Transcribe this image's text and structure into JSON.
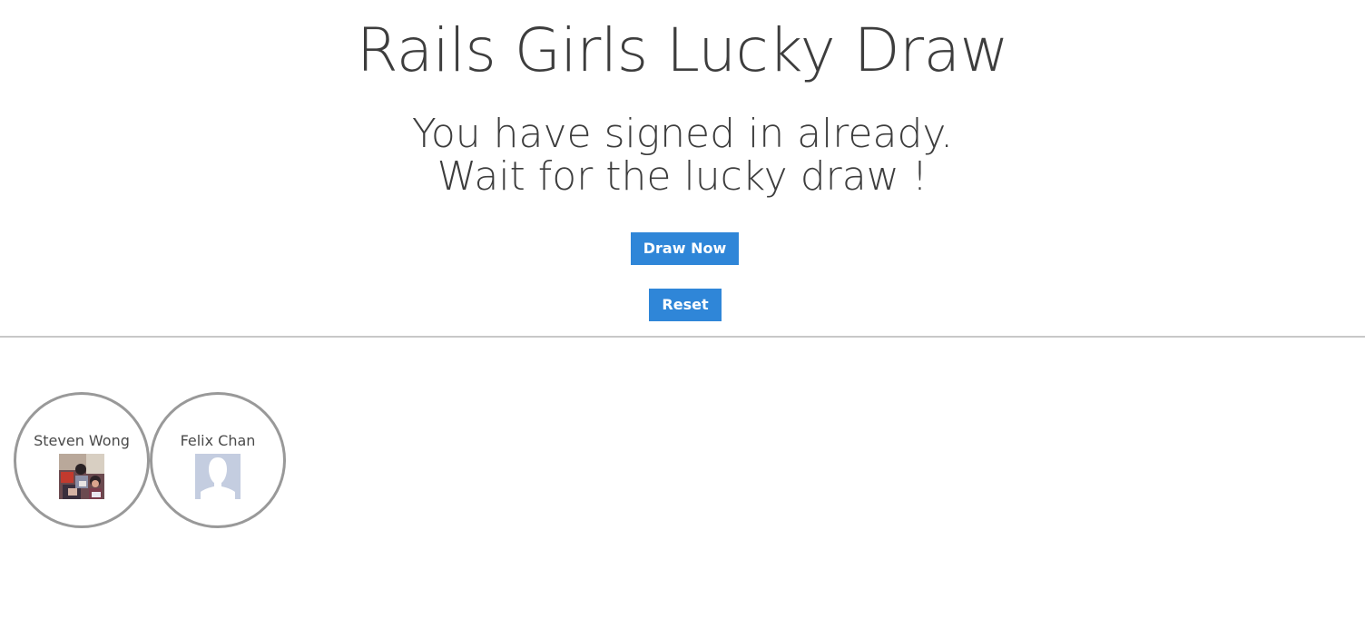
{
  "page": {
    "title": "Rails Girls Lucky Draw",
    "status_line_1": "You have signed in already.",
    "status_line_2": "Wait for the lucky draw !"
  },
  "actions": {
    "draw_label": "Draw Now",
    "reset_label": "Reset"
  },
  "colors": {
    "button": "#2f86d8",
    "circle_border": "#999999",
    "divider": "#c8c8c8"
  },
  "participants": [
    {
      "name": "Steven Wong",
      "avatar": "photo-avatar"
    },
    {
      "name": "Felix Chan",
      "avatar": "default-silhouette-avatar"
    }
  ]
}
